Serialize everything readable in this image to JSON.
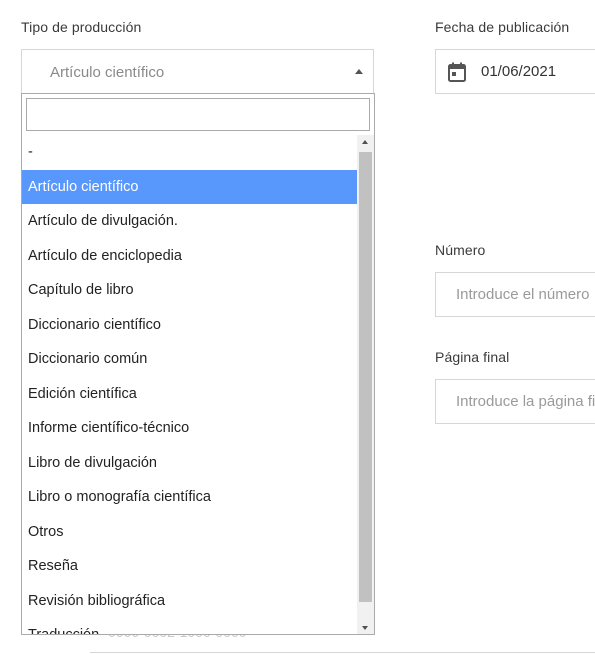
{
  "fields": {
    "production_type_label": "Tipo de producción",
    "production_type_value": "Artículo científico",
    "publication_date_label": "Fecha de publicación",
    "publication_date_value": "01/06/2021",
    "number_label": "Número",
    "number_placeholder": "Introduce el número",
    "last_page_label": "Página final",
    "last_page_placeholder": "Introduce la página fi"
  },
  "background_text": "0000-0002-1000-0000",
  "dropdown": {
    "search_value": "",
    "options": [
      {
        "label": "-"
      },
      {
        "label": "Artículo científico",
        "selected": true
      },
      {
        "label": "Artículo de divulgación."
      },
      {
        "label": "Artículo de enciclopedia"
      },
      {
        "label": "Capítulo de libro"
      },
      {
        "label": "Diccionario científico"
      },
      {
        "label": "Diccionario común"
      },
      {
        "label": "Edición científica"
      },
      {
        "label": "Informe científico-técnico"
      },
      {
        "label": "Libro de divulgación"
      },
      {
        "label": "Libro o monografía científica"
      },
      {
        "label": "Otros"
      },
      {
        "label": "Reseña"
      },
      {
        "label": "Revisión bibliográfica"
      },
      {
        "label": "Traducción"
      }
    ]
  },
  "colors": {
    "selected_option": "#5897fb",
    "border": "#d6d6d6"
  },
  "icons": {
    "date_field": "calendar-icon",
    "select_toggle": "caret-up-icon"
  }
}
